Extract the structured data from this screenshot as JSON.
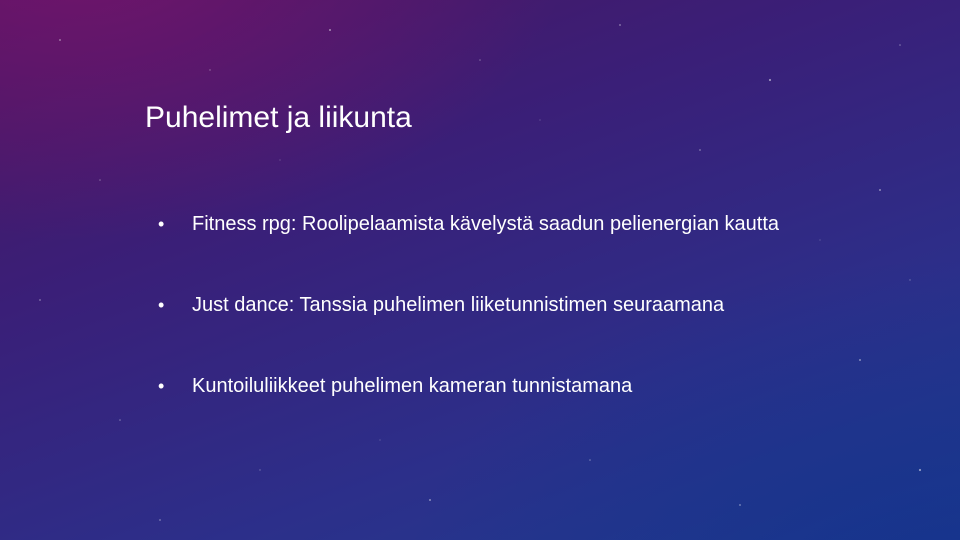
{
  "slide": {
    "title": "Puhelimet ja liikunta",
    "bullets": [
      "Fitness rpg: Roolipelaamista kävelystä saadun pelienergian kautta",
      "Just dance: Tanssia puhelimen liiketunnistimen seuraamana",
      "Kuntoiluliikkeet puhelimen kameran tunnistamana"
    ],
    "bullet_symbol": "•"
  },
  "colors": {
    "text": "#ffffff",
    "background_top_left": "#4a1660",
    "background_bottom_right": "#1f3c8f"
  }
}
